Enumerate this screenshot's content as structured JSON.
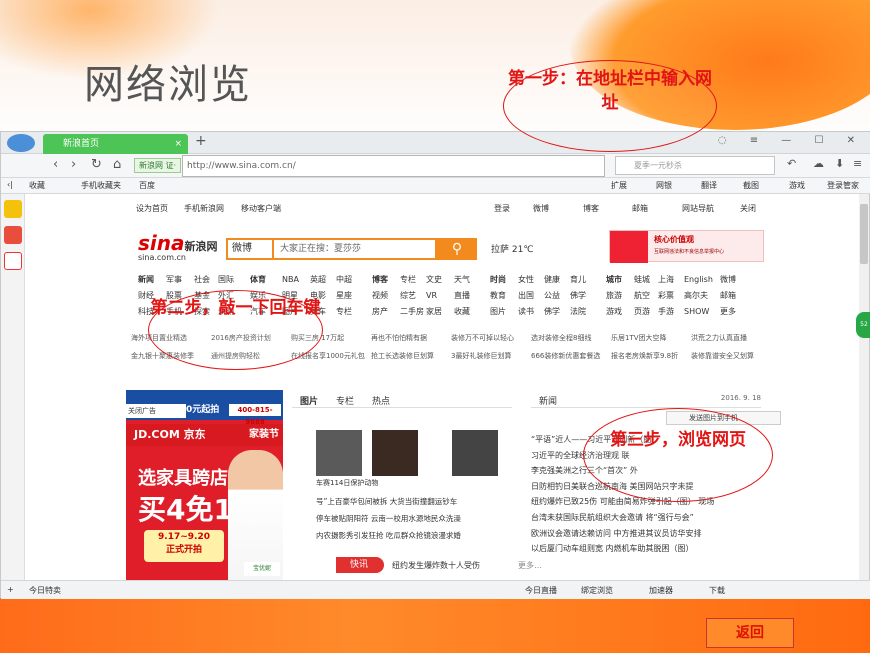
{
  "slide": {
    "title": "网络浏览",
    "back_label": "返回"
  },
  "callouts": {
    "step1": "第一步：在地址栏中输入网址",
    "step2": "第二步，敲一下回车键",
    "step3": "第三步，浏览网页"
  },
  "browser": {
    "tab_title": "新浪首页",
    "tab_close": "×",
    "new_tab": "+",
    "site_badge": "新浪网 证·",
    "url": "http://www.sina.com.cn/",
    "search_placeholder": "夏季一元秒杀",
    "favorites": [
      "收藏",
      "手机收藏夹",
      "百度"
    ],
    "toolbar_right": [
      "扩展",
      "网银",
      "翻译",
      "截图",
      "游戏",
      "登录管家"
    ],
    "status_left": "今日特卖",
    "status_right": [
      "今日直播",
      "绑定浏览",
      "加速器",
      "下载"
    ]
  },
  "sina": {
    "topnav": [
      "设为首页",
      "手机新浪网",
      "移动客户端",
      "登录",
      "微博",
      "博客",
      "邮箱",
      "网站导航",
      "关闭"
    ],
    "logo": "新浪网",
    "logo_s": "sina",
    "domain": "sina.com.cn",
    "search_select": "微博",
    "search_placeholder": "大家正在搜：夏莎莎",
    "weather": "拉萨  21℃",
    "banner_title": "核心价值观",
    "banner_sub": "互联网违法和不良信息举报中心",
    "grid_cols": [
      [
        "新闻",
        "财经",
        "科技"
      ],
      [
        "军事",
        "股票",
        "手机"
      ],
      [
        "社会",
        "基金",
        "探索"
      ],
      [
        "国际",
        "外汇",
        "众测"
      ],
      [
        "体育",
        "娱乐",
        "汽车"
      ],
      [
        "NBA",
        "明星",
        "图片"
      ],
      [
        "英超",
        "电影",
        "买车"
      ],
      [
        "中超",
        "星座",
        "专栏"
      ],
      [
        "博客",
        "视频",
        "房产"
      ],
      [
        "专栏",
        "综艺",
        "二手房"
      ],
      [
        "文史",
        "VR",
        "家居"
      ],
      [
        "天气",
        "直播",
        "收藏"
      ],
      [
        "时尚",
        "教育",
        "图片"
      ],
      [
        "女性",
        "出国",
        "读书"
      ],
      [
        "健康",
        "公益",
        "佛学"
      ],
      [
        "育儿",
        "佛学",
        "法院"
      ],
      [
        "城市",
        "旅游",
        "游戏"
      ],
      [
        "蛙城",
        "航空",
        "页游"
      ],
      [
        "上海",
        "彩票",
        "手游"
      ],
      [
        "English",
        "高尔夫",
        "SHOW"
      ],
      [
        "微博",
        "邮箱",
        "更多"
      ]
    ],
    "ad_row1": [
      "海外项目置业精选",
      "2016房产投资计划",
      "购买三房 17万起",
      "再也不怕怕精有据",
      "装修万不可掉以轻心",
      "选对装修全程8细线",
      "乐居1TV团大空降",
      "洪荒之力认真直播"
    ],
    "ad_row2": [
      "金九银十聚惠装修季",
      "通州提房购轻松",
      "在线报名享1000元礼包",
      "抢工长选装修巨划算",
      "3最好礼装修巨划算",
      "666装修新优惠套餐选",
      "报名老房焕新享9.8折",
      "装修靠谱安全又划算"
    ],
    "left_ad": {
      "close": "关闭广告",
      "zero": "0元起拍",
      "phone": "400-815-9888",
      "jd": "JD.COM 京东",
      "jd_right": "家装节",
      "line1": "选家具跨店",
      "line2": "买4免1",
      "date1": "9.17~9.20",
      "date2": "正式开拍",
      "brand": "宝优妮"
    },
    "mid_tabs": [
      "图片",
      "专栏",
      "热点"
    ],
    "mid_caption": "车赛114日保护动物",
    "mid_news": [
      "号”上百豪华包间被拆 大货当街撞翻运钞车",
      "停车被贴阴阳符 云南一校用水源地民众洗澡",
      "内农摄影秀引发狂抢 吃瓜群众抢镜浪漫求婚",
      "约发生爆炸数十人受伤"
    ],
    "kuaixun": "快讯",
    "kuaixun_text": "纽约发生爆炸数十人受伤",
    "kuaixun_more": "更多…",
    "right_tab": "新闻",
    "right_date": "2016. 9. 18",
    "send_pic": "发送图片到手机",
    "right_news": [
      "“平语”近人——习近平谈创新（图）",
      "习近平的全球经济治理观 联",
      "李克强美洲之行三个“首次” 外",
      "日防相钓日美联合巡航南海 美国网站只字未提",
      "纽约爆炸已致25伤 可能由简易炸弹引起（图） 现场",
      "台湾未获国际民航组织大会邀请 将“强行与会”",
      "欧洲议会邀请达赖访问 中方推进其议员访华安排",
      "以后厦门动车组则宽 内燃机车助其脱困（图）"
    ]
  }
}
